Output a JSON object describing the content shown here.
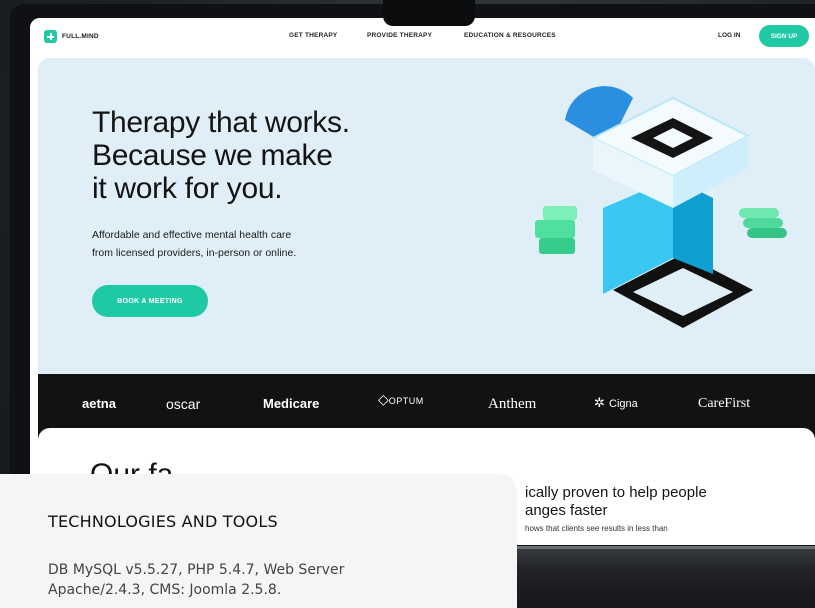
{
  "nav": {
    "logo": "FULL.MIND",
    "links": [
      "GET THERAPY",
      "PROVIDE THERAPY",
      "EDUCATION & RESOURCES"
    ],
    "login": "LOG IN",
    "signup": "SIGN UP"
  },
  "hero": {
    "title_lines": [
      "Therapy that works.",
      "Because we make",
      "it work for you."
    ],
    "subtitle_lines": [
      "Affordable and effective mental health care",
      "from licensed providers, in-person or online."
    ],
    "cta": "BOOK A MEETING"
  },
  "insurers": [
    "aetna",
    "oscar",
    "Medicare",
    "OPTUM",
    "Anthem",
    "Cigna",
    "CareFirst"
  ],
  "lower": {
    "heading_partial": "Our fa",
    "title_lines": [
      "ically proven to help people",
      "anges faster"
    ],
    "text": "hows that clients see results in less than"
  },
  "card": {
    "title": "TECHNOLOGIES AND TOOLS",
    "text_lines": [
      "DB MySQL v5.5.27, PHP 5.4.7, Web Server",
      "Apache/2.4.3, CMS: Joomla 2.5.8."
    ]
  },
  "colors": {
    "accent": "#1fc9a4",
    "hero_bg": "#dfeef7",
    "insurer_bar": "#121212"
  }
}
